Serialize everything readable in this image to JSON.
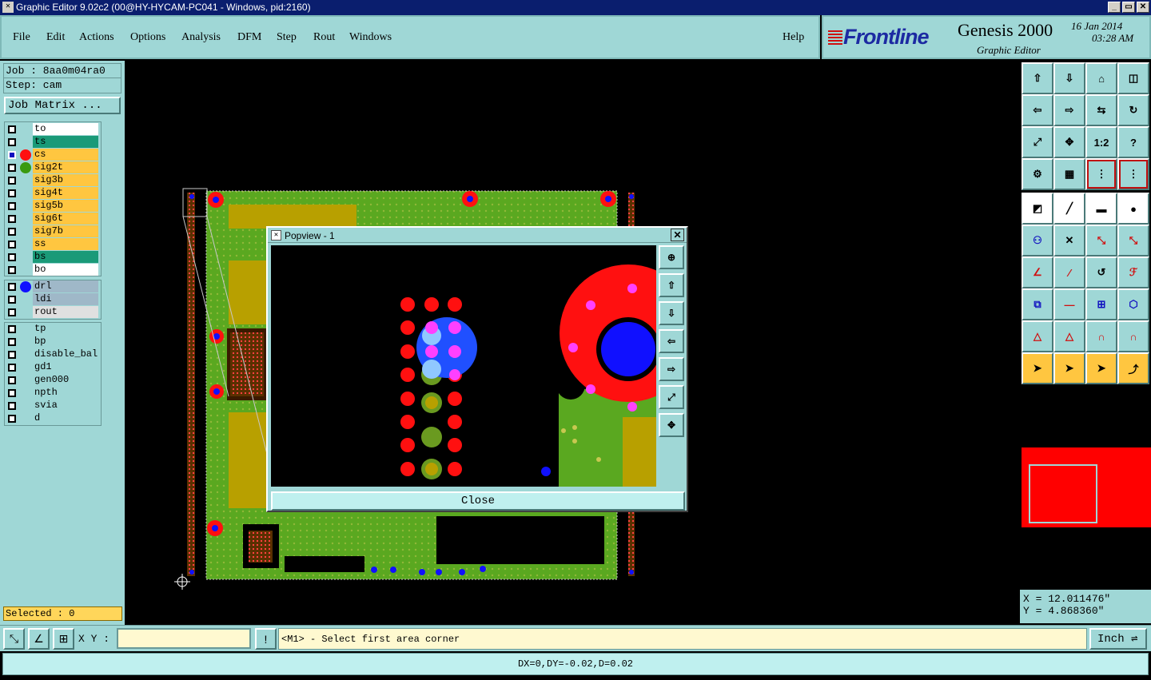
{
  "window": {
    "title": "Graphic Editor 9.02c2 (00@HY-HYCAM-PC041 - Windows, pid:2160)",
    "min_glyph": "_",
    "max_glyph": "▭",
    "close_glyph": "✕"
  },
  "menu": [
    {
      "label": "File"
    },
    {
      "label": "Edit"
    },
    {
      "label": "Actions"
    },
    {
      "label": "Options"
    },
    {
      "label": "Analysis"
    },
    {
      "label": "DFM"
    },
    {
      "label": "Step"
    },
    {
      "label": "Rout"
    },
    {
      "label": "Windows"
    },
    {
      "label": "Help"
    }
  ],
  "brand": {
    "logo": "Frontline",
    "product": "Genesis 2000",
    "subtitle": "Graphic Editor",
    "date": "16 Jan 2014",
    "time": "03:28 AM"
  },
  "job": {
    "job_line": "Job : 8aa0m04ra0",
    "step_line": "Step: cam",
    "matrix_button": "Job Matrix ..."
  },
  "layers": {
    "board": [
      {
        "name": "to",
        "bg": "#ffffff",
        "dot": "",
        "selected": false
      },
      {
        "name": "ts",
        "bg": "#1a9a78",
        "dot": "",
        "selected": false
      },
      {
        "name": "cs",
        "bg": "#ffc640",
        "dot": "#ff1010",
        "selected": true
      },
      {
        "name": "sig2t",
        "bg": "#ffc640",
        "dot": "#3a9a10",
        "selected": false
      },
      {
        "name": "sig3b",
        "bg": "#ffc640",
        "dot": "",
        "selected": false
      },
      {
        "name": "sig4t",
        "bg": "#ffc640",
        "dot": "",
        "selected": false
      },
      {
        "name": "sig5b",
        "bg": "#ffc640",
        "dot": "",
        "selected": false
      },
      {
        "name": "sig6t",
        "bg": "#ffc640",
        "dot": "",
        "selected": false
      },
      {
        "name": "sig7b",
        "bg": "#ffc640",
        "dot": "",
        "selected": false
      },
      {
        "name": "ss",
        "bg": "#ffc640",
        "dot": "",
        "selected": false
      },
      {
        "name": "bs",
        "bg": "#1a9a78",
        "dot": "",
        "selected": false
      },
      {
        "name": "bo",
        "bg": "#ffffff",
        "dot": "",
        "selected": false
      }
    ],
    "drill": [
      {
        "name": "drl",
        "bg": "#9fb8c8",
        "dot": "#1010ff",
        "selected": false
      },
      {
        "name": "ldi",
        "bg": "#9fb8c8",
        "dot": "",
        "selected": false
      },
      {
        "name": "rout",
        "bg": "#e0e0e0",
        "dot": "",
        "selected": false
      }
    ],
    "misc": [
      {
        "name": "tp",
        "bg": "#9fd7d6",
        "dot": "",
        "selected": false
      },
      {
        "name": "bp",
        "bg": "#9fd7d6",
        "dot": "",
        "selected": false
      },
      {
        "name": "disable_bal",
        "bg": "#9fd7d6",
        "dot": "",
        "selected": false
      },
      {
        "name": "gd1",
        "bg": "#9fd7d6",
        "dot": "",
        "selected": false
      },
      {
        "name": "gen000",
        "bg": "#9fd7d6",
        "dot": "",
        "selected": false
      },
      {
        "name": "npth",
        "bg": "#9fd7d6",
        "dot": "",
        "selected": false
      },
      {
        "name": "svia",
        "bg": "#9fd7d6",
        "dot": "",
        "selected": false
      },
      {
        "name": "d",
        "bg": "#9fd7d6",
        "dot": "",
        "selected": false
      }
    ]
  },
  "selected": "Selected : 0",
  "popview": {
    "title": "Popview - 1",
    "close": "Close"
  },
  "coords": {
    "x": "X = 12.011476\"",
    "y": "Y = 4.868360\""
  },
  "bottom": {
    "xy_label": "X Y :",
    "xy_value": "",
    "message": "<M1> - Select first area corner",
    "unit": "Inch ⇌",
    "status": "DX=0,DY=-0.02,D=0.02"
  },
  "colors": {
    "panel": "#9fd7d6",
    "pcb_green": "#5aa820",
    "pcb_gold": "#b8a000",
    "pad_red": "#ff1010",
    "via_blue": "#1010ff",
    "magenta": "#ff40ff"
  }
}
